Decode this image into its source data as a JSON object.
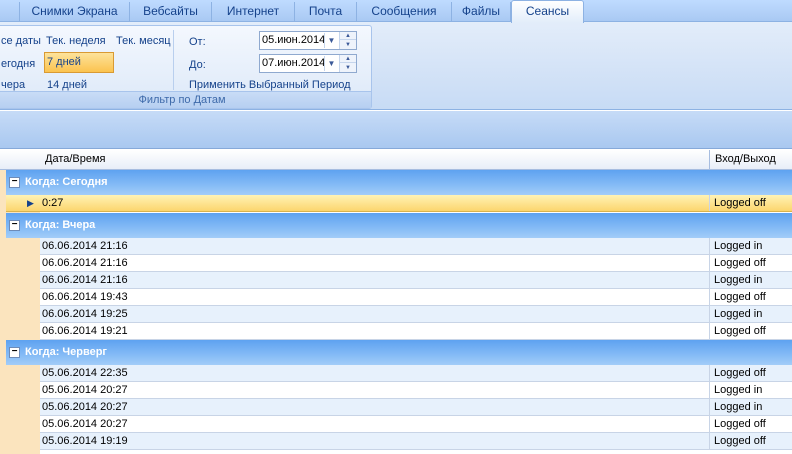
{
  "ribbon_tabs": [
    {
      "label": "Снимки Экрана"
    },
    {
      "label": "Вебсайты"
    },
    {
      "label": "Интернет"
    },
    {
      "label": "Почта"
    },
    {
      "label": "Сообщения"
    },
    {
      "label": "Файлы"
    },
    {
      "label": "Сеансы"
    }
  ],
  "active_tab": "Сеансы",
  "filter_group": {
    "caption": "Фильтр по Датам",
    "all_dates": "се даты",
    "week": "Тек. неделя",
    "month": "Тек. месяц",
    "today": "егодня",
    "seven_days": "7 дней",
    "yesterday": "чера",
    "fourteen_days": "14 дней",
    "from_label": "От:",
    "from_value": "05.июн.2014",
    "to_label": "До:",
    "to_value": "07.июн.2014",
    "apply": "Применить Выбранный Период"
  },
  "grid": {
    "col_datetime": "Дата/Время",
    "col_status": "Вход/Выход",
    "groups": [
      {
        "title": "Когда: Сегодня",
        "rows": [
          {
            "time": "0:27",
            "status": "Logged off"
          }
        ]
      },
      {
        "title": "Когда: Вчера",
        "rows": [
          {
            "time": "06.06.2014 21:16",
            "status": "Logged in"
          },
          {
            "time": "06.06.2014 21:16",
            "status": "Logged off"
          },
          {
            "time": "06.06.2014 21:16",
            "status": "Logged in"
          },
          {
            "time": "06.06.2014 19:43",
            "status": "Logged off"
          },
          {
            "time": "06.06.2014 19:25",
            "status": "Logged in"
          },
          {
            "time": "06.06.2014 19:21",
            "status": "Logged off"
          }
        ]
      },
      {
        "title": "Когда: Черверг",
        "rows": [
          {
            "time": "05.06.2014 22:35",
            "status": "Logged off"
          },
          {
            "time": "05.06.2014 20:27",
            "status": "Logged in"
          },
          {
            "time": "05.06.2014 20:27",
            "status": "Logged in"
          },
          {
            "time": "05.06.2014 20:27",
            "status": "Logged off"
          },
          {
            "time": "05.06.2014 19:19",
            "status": "Logged off"
          }
        ]
      }
    ]
  },
  "colors": {
    "group_header": "#72b0f3",
    "focused_row": "#fcd56e",
    "ribbon_text": "#15428b"
  }
}
